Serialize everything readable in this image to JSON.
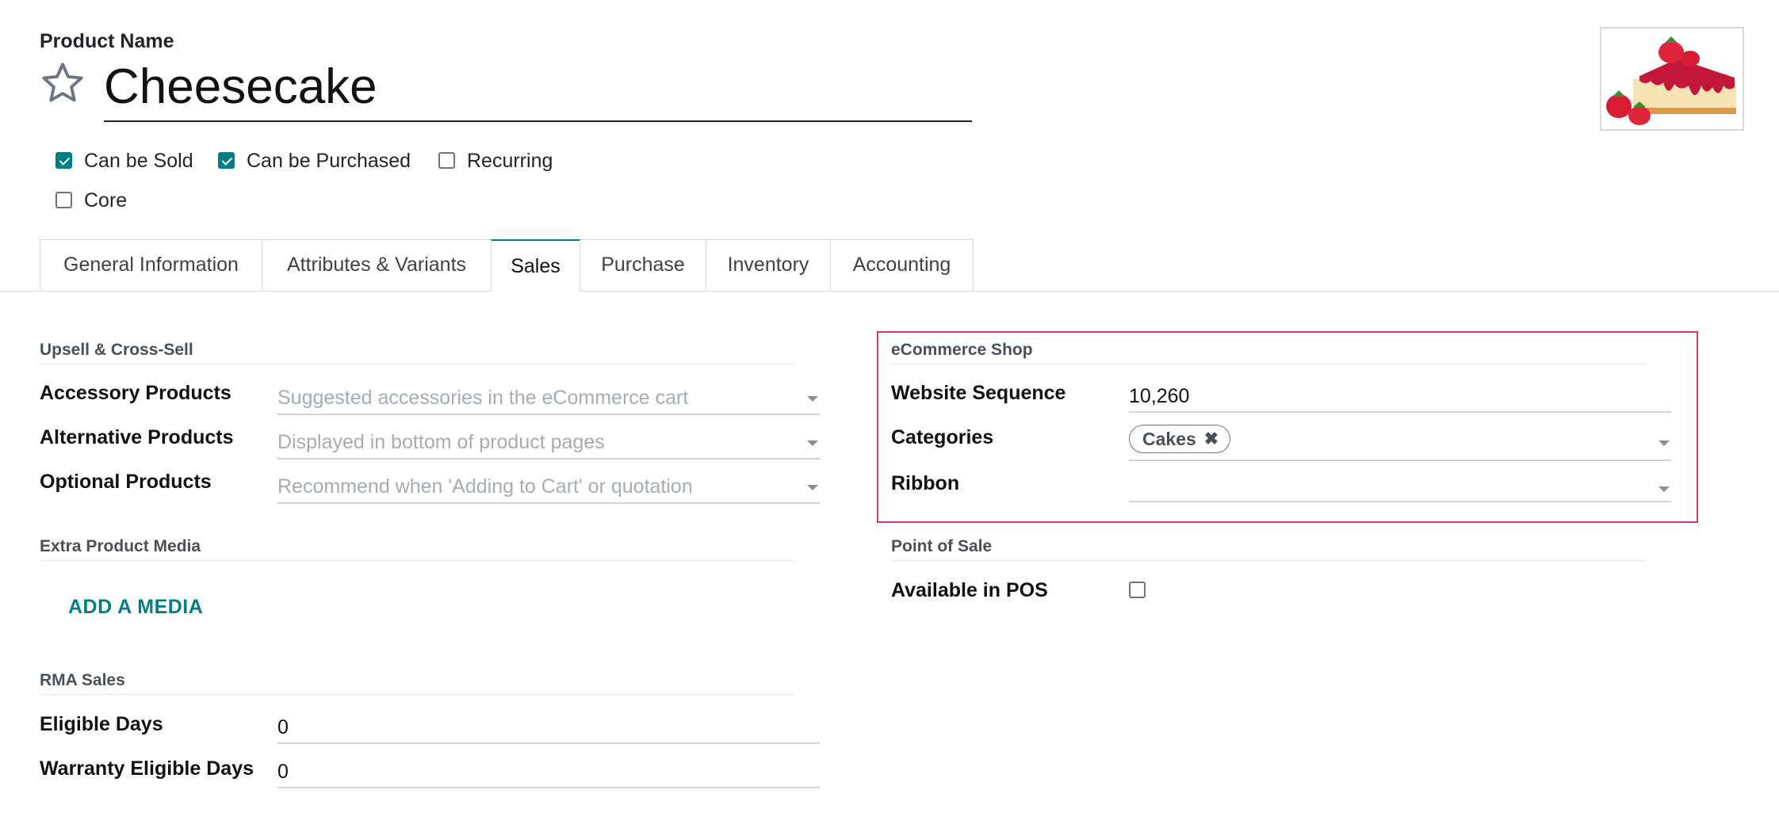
{
  "header": {
    "product_label": "Product Name",
    "product_name": "Cheesecake",
    "favorite_icon": "star-outline-icon",
    "image_description": "cheesecake-with-strawberries"
  },
  "options": [
    {
      "label": "Can be Sold",
      "checked": true
    },
    {
      "label": "Can be Purchased",
      "checked": true
    },
    {
      "label": "Recurring",
      "checked": false
    },
    {
      "label": "Core",
      "checked": false
    }
  ],
  "tabs": [
    {
      "label": "General Information",
      "active": false
    },
    {
      "label": "Attributes & Variants",
      "active": false
    },
    {
      "label": "Sales",
      "active": true
    },
    {
      "label": "Purchase",
      "active": false
    },
    {
      "label": "Inventory",
      "active": false
    },
    {
      "label": "Accounting",
      "active": false
    }
  ],
  "upsell": {
    "title": "Upsell & Cross-Sell",
    "fields": [
      {
        "label": "Accessory Products",
        "placeholder": "Suggested accessories in the eCommerce cart"
      },
      {
        "label": "Alternative Products",
        "placeholder": "Displayed in bottom of product pages"
      },
      {
        "label": "Optional Products",
        "placeholder": "Recommend when 'Adding to Cart' or quotation"
      }
    ]
  },
  "extra_media": {
    "title": "Extra Product Media",
    "add_label": "ADD A MEDIA"
  },
  "rma": {
    "title": "RMA Sales",
    "fields": [
      {
        "label": "Eligible Days",
        "value": "0"
      },
      {
        "label": "Warranty Eligible Days",
        "value": "0"
      }
    ]
  },
  "ecommerce": {
    "title": "eCommerce Shop",
    "website_sequence_label": "Website Sequence",
    "website_sequence_value": "10,260",
    "categories_label": "Categories",
    "categories_tags": [
      "Cakes"
    ],
    "ribbon_label": "Ribbon",
    "ribbon_value": ""
  },
  "pos": {
    "title": "Point of Sale",
    "available_label": "Available in POS",
    "available_checked": false
  },
  "colors": {
    "accent": "#017e84",
    "highlight_border": "#d63a61"
  }
}
